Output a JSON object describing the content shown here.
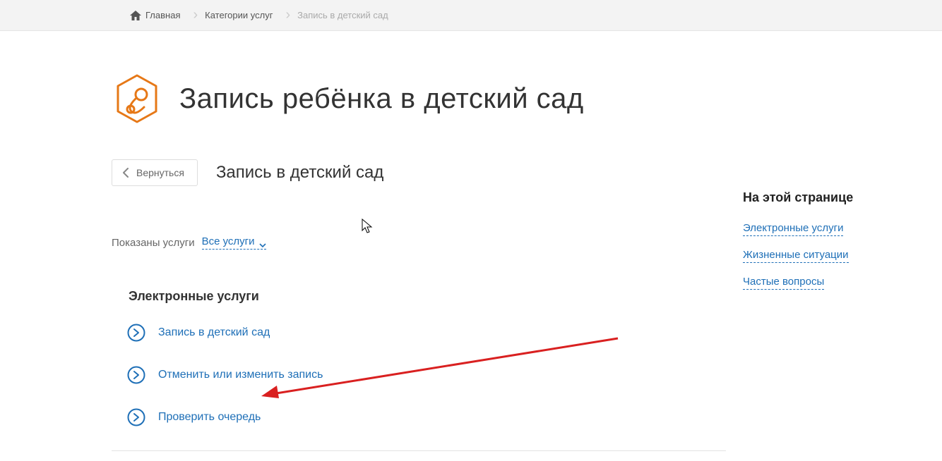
{
  "breadcrumb": {
    "home": "Главная",
    "categories": "Категории услуг",
    "current": "Запись в детский сад"
  },
  "page": {
    "title": "Запись ребёнка в детский сад",
    "back_label": "Вернуться",
    "subtitle": "Запись в детский сад"
  },
  "filter": {
    "label": "Показаны услуги",
    "selected": "Все услуги"
  },
  "section": {
    "heading": "Электронные услуги"
  },
  "services": [
    {
      "label": "Запись в детский сад"
    },
    {
      "label": "Отменить или изменить запись"
    },
    {
      "label": "Проверить очередь"
    }
  ],
  "sidebar": {
    "title": "На этой странице",
    "links": [
      "Электронные услуги",
      "Жизненные ситуации",
      "Частые вопросы"
    ]
  }
}
